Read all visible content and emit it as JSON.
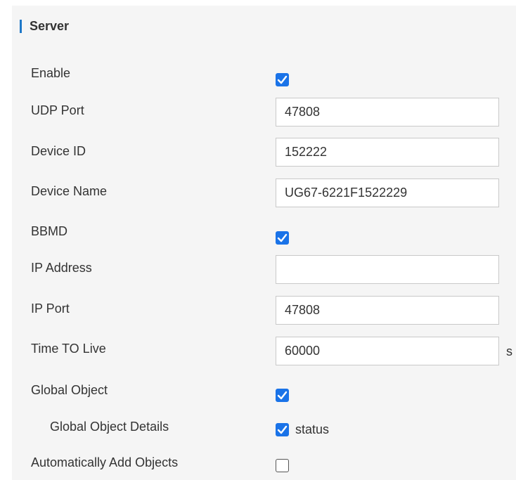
{
  "section": {
    "title": "Server"
  },
  "fields": {
    "enable": {
      "label": "Enable",
      "checked": true
    },
    "udp_port": {
      "label": "UDP Port",
      "value": "47808"
    },
    "device_id": {
      "label": "Device ID",
      "value": "152222"
    },
    "device_name": {
      "label": "Device Name",
      "value": "UG67-6221F1522229"
    },
    "bbmd": {
      "label": "BBMD",
      "checked": true
    },
    "ip_address": {
      "label": "IP Address",
      "value": ""
    },
    "ip_port": {
      "label": "IP Port",
      "value": "47808"
    },
    "time_to_live": {
      "label": "Time TO Live",
      "value": "60000",
      "unit": "s"
    },
    "global_object": {
      "label": "Global Object",
      "checked": true
    },
    "global_object_details": {
      "label": "Global Object Details",
      "checked": true,
      "option_label": "status"
    },
    "auto_add_objects": {
      "label": "Automatically Add Objects",
      "checked": false
    }
  },
  "colors": {
    "accent": "#1a73e8",
    "section_bar": "#1e78c8",
    "panel_bg": "#f5f5f5",
    "text": "#333333"
  }
}
